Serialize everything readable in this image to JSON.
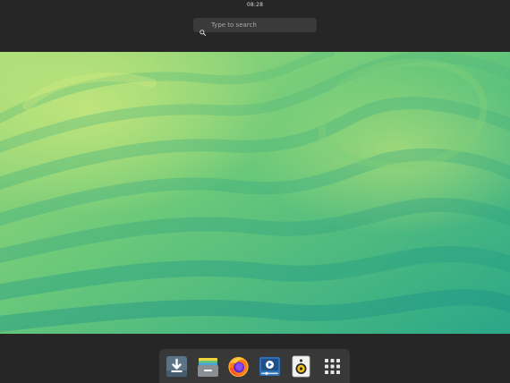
{
  "top_bar": {
    "clock": "08:28"
  },
  "search": {
    "placeholder": "Type to search",
    "icon": "search-icon"
  },
  "workspace": {
    "wallpaper": "green-yellow-wave",
    "colors": {
      "light": "#b6e07a",
      "mid": "#5cc47e",
      "dark": "#1e9a86"
    }
  },
  "dock": {
    "items": [
      {
        "name": "downloads",
        "icon": "download-icon"
      },
      {
        "name": "files",
        "icon": "archive-icon"
      },
      {
        "name": "firefox",
        "icon": "firefox-icon"
      },
      {
        "name": "video-player",
        "icon": "video-player-icon"
      },
      {
        "name": "rhythmbox",
        "icon": "speaker-icon"
      },
      {
        "name": "show-apps",
        "icon": "app-grid-icon"
      }
    ]
  }
}
